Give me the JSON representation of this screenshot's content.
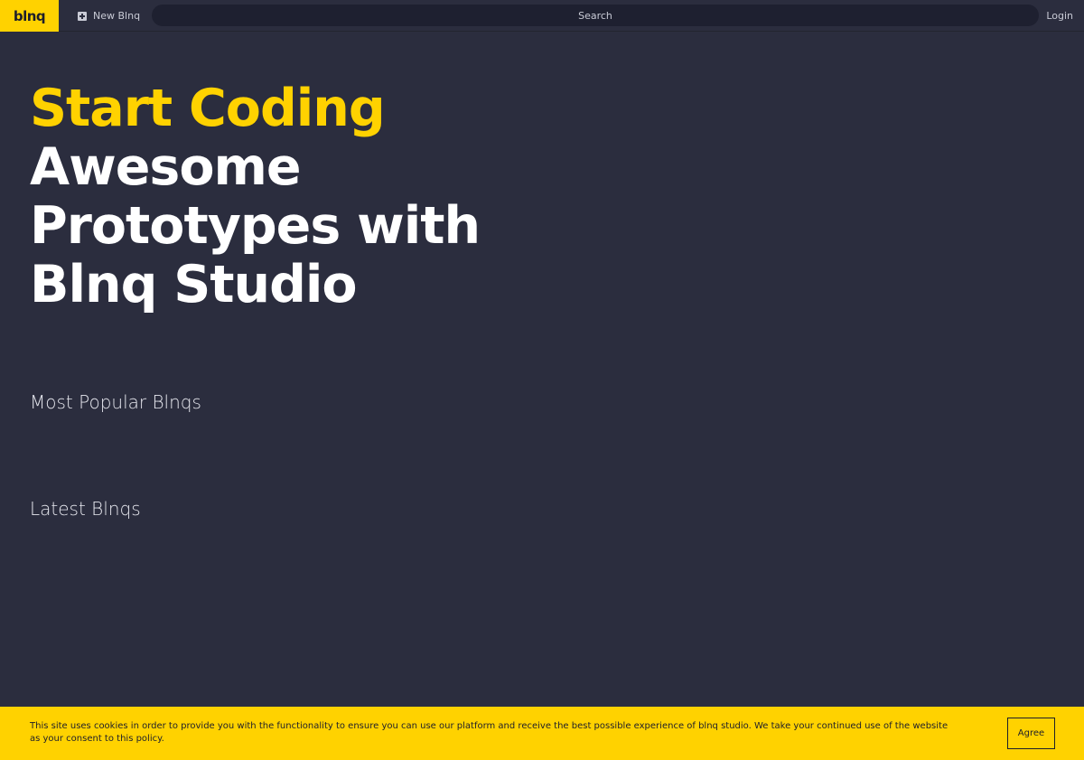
{
  "header": {
    "logo": "blnq",
    "new_blnq_label": "New Blnq",
    "new_blnq_icon": "plus-square-icon",
    "search_placeholder": "Search",
    "login_label": "Login"
  },
  "hero": {
    "accent_line": "Start Coding",
    "line_2": "Awesome",
    "line_3": "Prototypes with",
    "line_4": "Blnq Studio"
  },
  "sections": {
    "popular_title": "Most Popular Blnqs",
    "latest_title": "Latest Blnqs"
  },
  "cookie": {
    "text": "This site uses cookies in order to provide you with the functionality to ensure you can use our platform and receive the best possible experience of blnq studio. We take your continued use of the website as your consent to this policy.",
    "agree_label": "Agree"
  },
  "colors": {
    "background": "#2b2d3e",
    "accent": "#ffd200",
    "text": "#ffffff"
  }
}
